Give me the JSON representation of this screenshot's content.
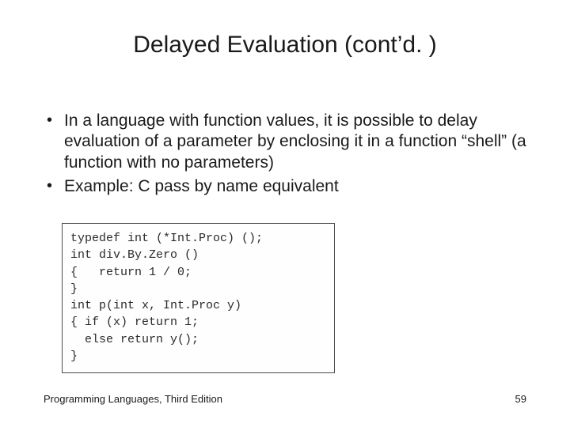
{
  "title": "Delayed Evaluation (cont’d. )",
  "bullets": [
    "In a language with function values, it is possible to delay evaluation of a parameter by enclosing it in a function “shell” (a function with no parameters)",
    "Example: C pass by name equivalent"
  ],
  "code": "typedef int (*Int.Proc) ();\nint div.By.Zero ()\n{   return 1 / 0;\n}\nint p(int x, Int.Proc y)\n{ if (x) return 1;\n  else return y();\n}",
  "footer": {
    "left": "Programming Languages, Third Edition",
    "page": "59"
  }
}
